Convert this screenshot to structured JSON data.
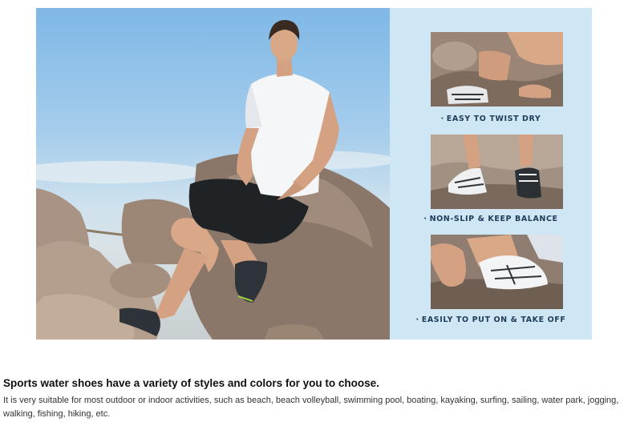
{
  "banner": {
    "features": [
      {
        "caption": "EASY TO TWIST DRY",
        "bullet": "·"
      },
      {
        "caption": "NON-SLIP & KEEP BALANCE",
        "bullet": "·"
      },
      {
        "caption": "EASILY TO PUT ON & TAKE OFF",
        "bullet": "·"
      }
    ],
    "colors": {
      "panel_bg": "#cfe7f5",
      "caption": "#1e3b57",
      "sky_top": "#7fb8e6"
    }
  },
  "description": {
    "heading": "Sports water shoes have a variety of styles and colors for you to choose.",
    "body": "It is very suitable for most outdoor or indoor activities, such as beach, beach volleyball, swimming pool, boating, kayaking, surfing, sailing, water park, jogging, walking, fishing, hiking, etc."
  }
}
